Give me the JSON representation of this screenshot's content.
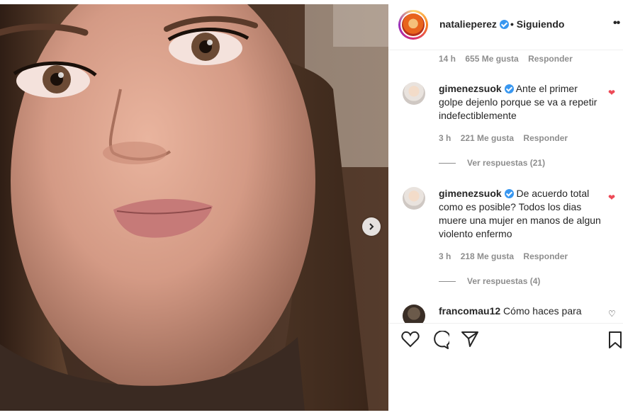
{
  "header": {
    "username": "natalieperez",
    "follow_status": "• Siguiendo",
    "more": "••"
  },
  "top_meta": {
    "time": "14 h",
    "likes": "655 Me gusta",
    "reply": "Responder"
  },
  "comments": [
    {
      "username": "gimenezsuok",
      "text": "Ante el primer golpe dejenlo porque se va a repetir indefectiblemente",
      "time": "3 h",
      "likes": "221 Me gusta",
      "reply": "Responder",
      "view_replies": "Ver respuestas (21)",
      "liked": true
    },
    {
      "username": "gimenezsuok",
      "text": "De acuerdo total como es posible? Todos los dias muere una mujer en manos de algun violento enfermo",
      "time": "3 h",
      "likes": "218 Me gusta",
      "reply": "Responder",
      "view_replies": "Ver respuestas (4)",
      "liked": true
    },
    {
      "username": "francomau12",
      "text": "Cómo haces para",
      "liked": false
    }
  ],
  "colors": {
    "accent": "#3897f0",
    "heart": "#ed4956",
    "muted": "#8e8e8e",
    "text": "#262626"
  },
  "icons": [
    "heart-icon",
    "comment-icon",
    "share-icon",
    "bookmark-icon",
    "next-arrow-icon",
    "verified-icon"
  ]
}
